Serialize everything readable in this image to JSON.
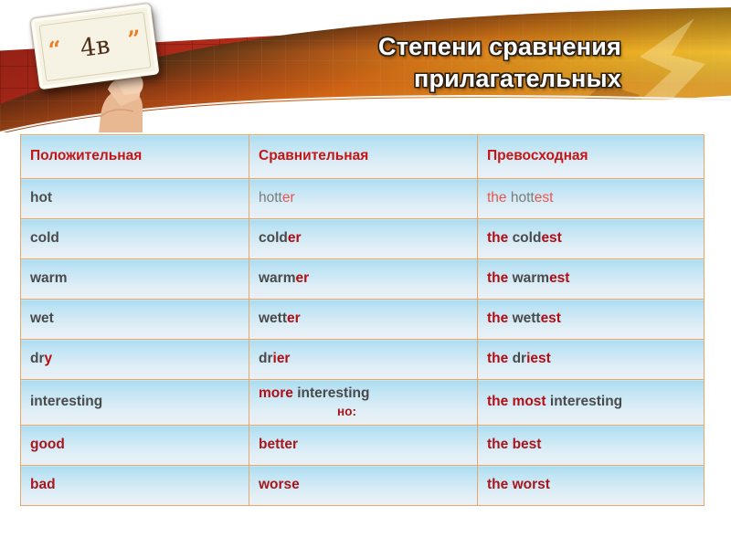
{
  "header": {
    "title_line1": "Степени сравнения",
    "title_line2": "прилагательных",
    "card": {
      "number": "4в",
      "quote_open": "“",
      "quote_close": "”"
    },
    "colors": {
      "title_text": "#ffffff",
      "title_outline": "#2b2013",
      "banner_green": "#1d3a1c",
      "banner_dark_red": "#7a1a12",
      "banner_orange": "#e8821a",
      "banner_yellow": "#f9c32b",
      "brick_red": "#a52418",
      "card_bg": "#f6f2e4",
      "card_number": "#4e2f18",
      "quote_orange": "#ef7a21"
    }
  },
  "table": {
    "colors": {
      "border": "#e8a76a",
      "header_text": "#c81414",
      "cell_top": "#a9dcf0",
      "cell_bottom": "#eaf1f5",
      "accent_red": "#b50d14",
      "irregular_red": "#a8161b",
      "base_gray": "#4a4a4a",
      "faded_gray": "#7b7b7b",
      "faded_red": "#e8574f"
    },
    "columns": [
      "Положительная",
      "Сравнительная",
      "Превосходная"
    ],
    "rows": [
      {
        "style": "faded",
        "positive": {
          "base": "hot",
          "bold": true
        },
        "comparative": {
          "stem": "hott",
          "suffix": "er"
        },
        "superlative": {
          "article": "the ",
          "stem": "hott",
          "suffix": "est"
        }
      },
      {
        "style": "normal",
        "positive": {
          "base": "cold"
        },
        "comparative": {
          "stem": "cold",
          "suffix": "er"
        },
        "superlative": {
          "article": "the ",
          "stem": "cold",
          "suffix": "est"
        }
      },
      {
        "style": "normal",
        "positive": {
          "base": "warm"
        },
        "comparative": {
          "stem": "warm",
          "suffix": "er"
        },
        "superlative": {
          "article": "the ",
          "stem": "warm",
          "suffix": "est"
        }
      },
      {
        "style": "normal",
        "positive": {
          "base": "wet"
        },
        "comparative": {
          "stem": "wett",
          "suffix": "er"
        },
        "superlative": {
          "article": "the ",
          "stem": "wett",
          "suffix": "est"
        }
      },
      {
        "style": "normal",
        "positive": {
          "base": "dr",
          "suffix": "y"
        },
        "comparative": {
          "stem": "dr",
          "suffix": "i",
          "tail": "er"
        },
        "superlative": {
          "article": "the ",
          "stem": "dr",
          "suffix": "i",
          "tail": "est"
        }
      },
      {
        "style": "normal",
        "tall": true,
        "positive": {
          "base": "interesting"
        },
        "comparative": {
          "prefix": "more ",
          "stem": "interesting",
          "note": "но:"
        },
        "superlative": {
          "prefix": "the most ",
          "stem": "interesting"
        }
      },
      {
        "style": "irregular",
        "positive": {
          "base": "good"
        },
        "comparative": {
          "stem": "better"
        },
        "superlative": {
          "article": "the ",
          "stem": "best"
        }
      },
      {
        "style": "irregular",
        "positive": {
          "base": "bad"
        },
        "comparative": {
          "stem": "worse"
        },
        "superlative": {
          "article": "the ",
          "stem": "worst"
        }
      }
    ]
  }
}
